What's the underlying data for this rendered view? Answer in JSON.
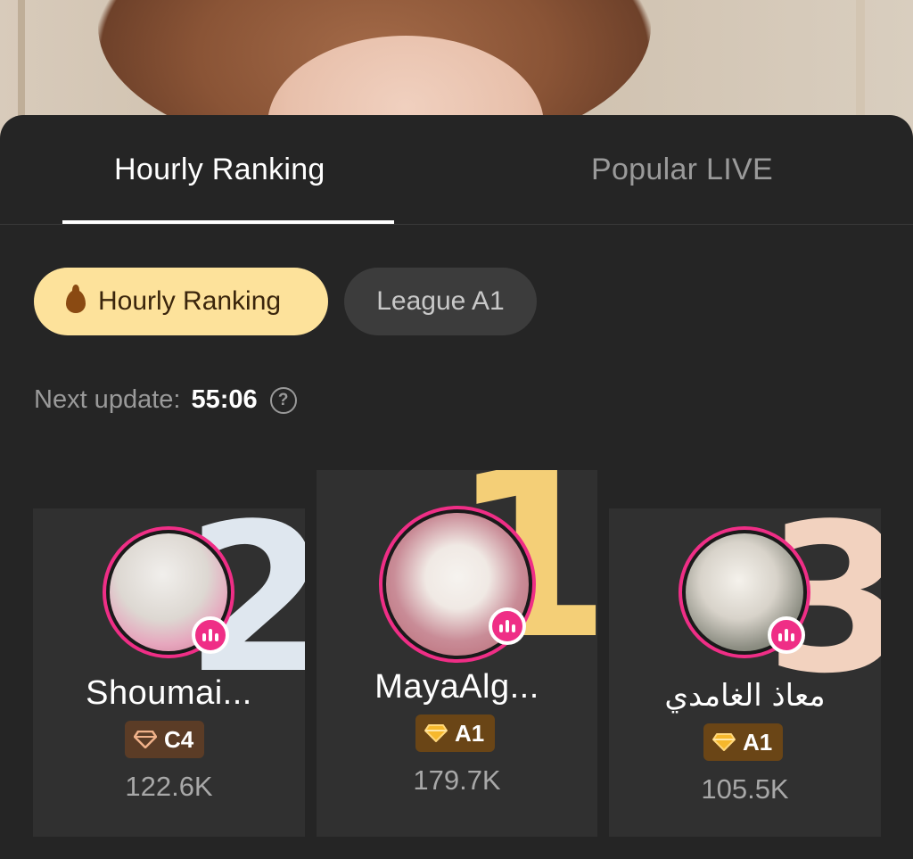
{
  "tabs": [
    {
      "label": "Hourly Ranking",
      "active": true
    },
    {
      "label": "Popular LIVE",
      "active": false
    }
  ],
  "filters": {
    "hourly_label": "Hourly Ranking",
    "league_label": "League A1"
  },
  "update": {
    "label": "Next update:",
    "time": "55:06",
    "help_icon": "?"
  },
  "ranking": [
    {
      "rank": "2",
      "name": "Shoumai...",
      "league": "C4",
      "score": "122.6K"
    },
    {
      "rank": "1",
      "name": "MayaAlg...",
      "league": "A1",
      "score": "179.7K"
    },
    {
      "rank": "3",
      "name": "معاذ الغامدي",
      "league": "A1",
      "score": "105.5K"
    }
  ],
  "colors": {
    "sheet_bg": "#252525",
    "card_bg": "#303030",
    "accent_pink": "#ef2e86",
    "pill_active": "#fde29b",
    "gold": "#f4cf77"
  }
}
